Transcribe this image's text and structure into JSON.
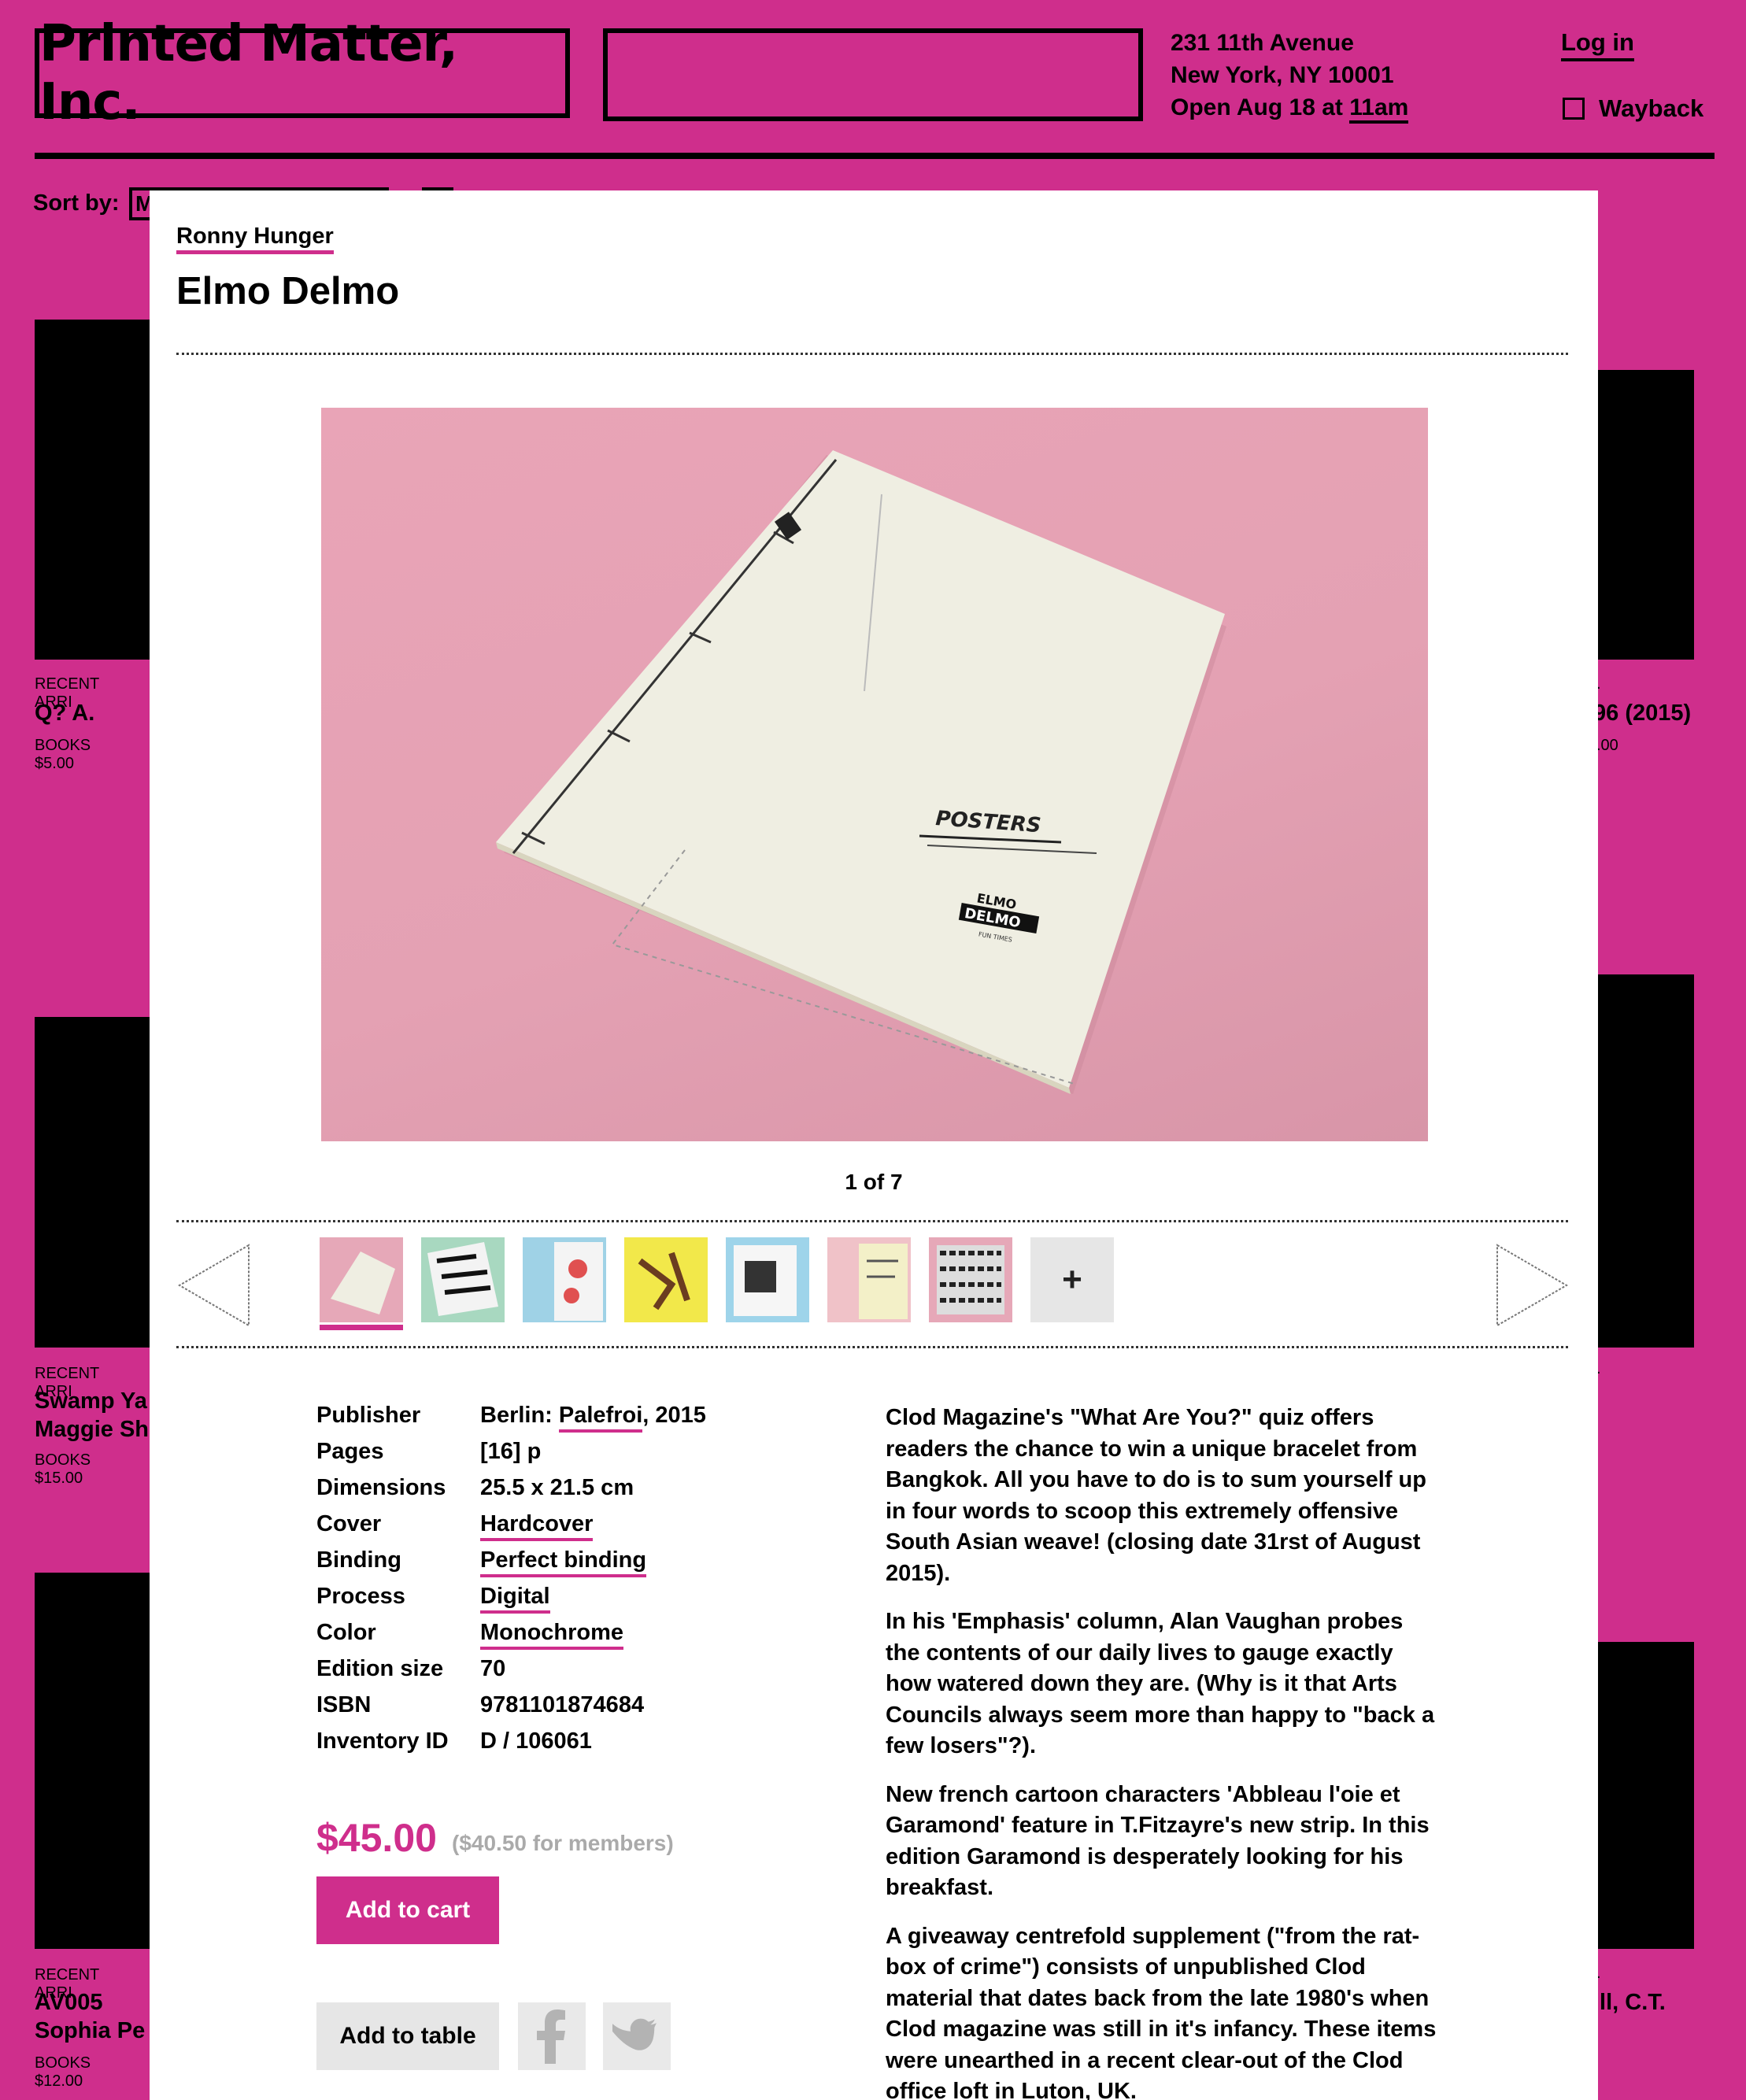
{
  "header": {
    "logo": "Printed Matter, Inc.",
    "address_line1": "231 11th Avenue",
    "address_line2": "New York, NY 10001",
    "hours_prefix": "Open Aug 18 at ",
    "hours_time": "11am",
    "login": "Log in",
    "wayback": "Wayback",
    "sort_label": "Sort by:",
    "sort_value": "M"
  },
  "grid": {
    "left_cards": [
      {
        "tag": "RECENT ARRI",
        "title": "Q? A.",
        "title2": "",
        "price": "BOOKS $5.00"
      },
      {
        "tag": "RECENT ARRI",
        "title": "Swamp Ya",
        "title2": "Maggie Sh",
        "price": "BOOKS $15.00"
      },
      {
        "tag": "RECENT ARRI",
        "title": "AV005",
        "title2": "Sophia Pe",
        "price": "BOOKS $12.00"
      }
    ],
    "right_cards": [
      {
        "tag": ".",
        "title": "96 (2015)",
        "price": ".00"
      },
      {
        "tag": ".",
        "title": "",
        "price": ""
      },
      {
        "tag": ".",
        "title": "ill, C.T.",
        "price": ""
      }
    ]
  },
  "product": {
    "author": "Ronny Hunger",
    "title": "Elmo Delmo",
    "image_counter": "1 of 7",
    "cover_text": "POSTERS",
    "cover_logo_line1": "ELMO",
    "cover_logo_line2": "DELMO",
    "cover_logo_sub": "FUN TIMES",
    "thumb_more": "+",
    "details": [
      {
        "label": "Publisher",
        "prefix": "Berlin: ",
        "link": "Palefroi",
        "suffix": ", 2015"
      },
      {
        "label": "Pages",
        "prefix": "[16] p",
        "link": "",
        "suffix": ""
      },
      {
        "label": "Dimensions",
        "prefix": "25.5 x 21.5 cm",
        "link": "",
        "suffix": ""
      },
      {
        "label": "Cover",
        "prefix": "",
        "link": "Hardcover",
        "suffix": ""
      },
      {
        "label": "Binding",
        "prefix": "",
        "link": "Perfect binding",
        "suffix": ""
      },
      {
        "label": "Process",
        "prefix": "",
        "link": "Digital",
        "suffix": ""
      },
      {
        "label": "Color",
        "prefix": "",
        "link": "Monochrome",
        "suffix": ""
      },
      {
        "label": "Edition size",
        "prefix": "70",
        "link": "",
        "suffix": ""
      },
      {
        "label": "ISBN",
        "prefix": "9781101874684",
        "link": "",
        "suffix": ""
      },
      {
        "label": "Inventory ID",
        "prefix": "D / 106061",
        "link": "",
        "suffix": ""
      }
    ],
    "price": "$45.00",
    "member_price": "($40.50 for members)",
    "add_to_cart": "Add to cart",
    "add_to_table": "Add to table",
    "description": [
      "Clod Magazine's \"What Are You?\" quiz offers readers the chance to win a unique bracelet from Bangkok. All you have to do is to sum yourself up in four words to scoop this extremely offensive South Asian weave! (closing date 31rst of August 2015).",
      "In his 'Emphasis' column, Alan Vaughan probes the contents of our daily lives to gauge exactly how watered down they are. (Why is it that Arts Councils always seem more than happy to \"back a few losers\"?).",
      "New french cartoon characters 'Abbleau l'oie et Garamond' feature in T.Fitzayre's new strip. In this edition Garamond is desperately looking for his breakfast.",
      "A giveaway centrefold supplement (\"from the rat-box of crime\") consists of unpublished Clod material that dates back from the late 1980's when Clod magazine was still in it's infancy. These items were unearthed in a recent clear-out of the Clod office loft in Luton, UK."
    ]
  },
  "colors": {
    "brand_magenta": "#cf2e8c",
    "member_grey": "#aaaaaa"
  },
  "icons": [
    "facebook-icon",
    "twitter-icon",
    "arrow-left-icon",
    "arrow-right-icon"
  ]
}
